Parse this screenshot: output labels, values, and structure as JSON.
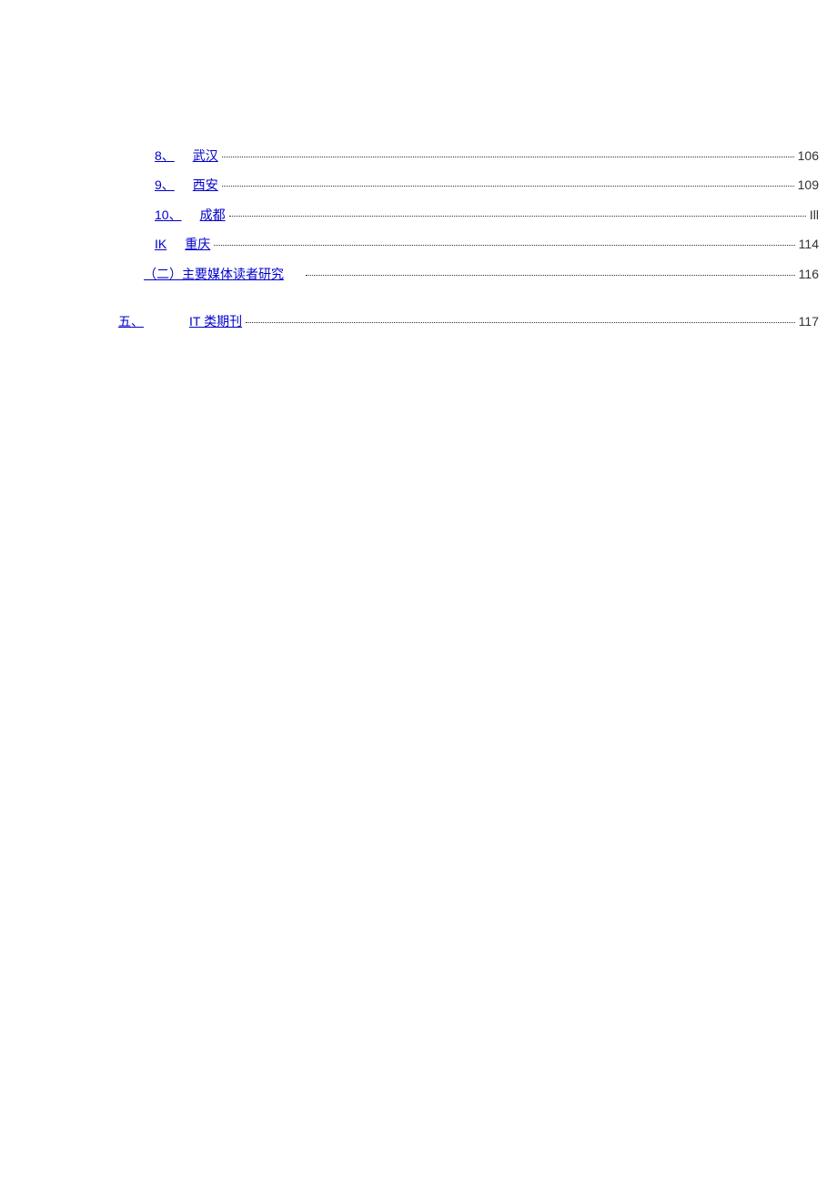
{
  "toc": {
    "entries": [
      {
        "prefix": "8、",
        "title": "武汉",
        "page": "106",
        "indent": "indent-1"
      },
      {
        "prefix": "9、",
        "title": "西安",
        "page": "109",
        "indent": "indent-1"
      },
      {
        "prefix": "10、",
        "title": "成都",
        "page": "Ill",
        "indent": "indent-1"
      },
      {
        "prefix": "IK",
        "title": "重庆",
        "page": "114",
        "indent": "indent-1"
      },
      {
        "prefix": "（二）主要媒体读者研究",
        "title": "",
        "page": "116",
        "indent": "indent-0"
      },
      {
        "prefix": "五、",
        "title": "IT 类期刊",
        "page": "117",
        "indent": "no-indent section-gap"
      }
    ]
  }
}
